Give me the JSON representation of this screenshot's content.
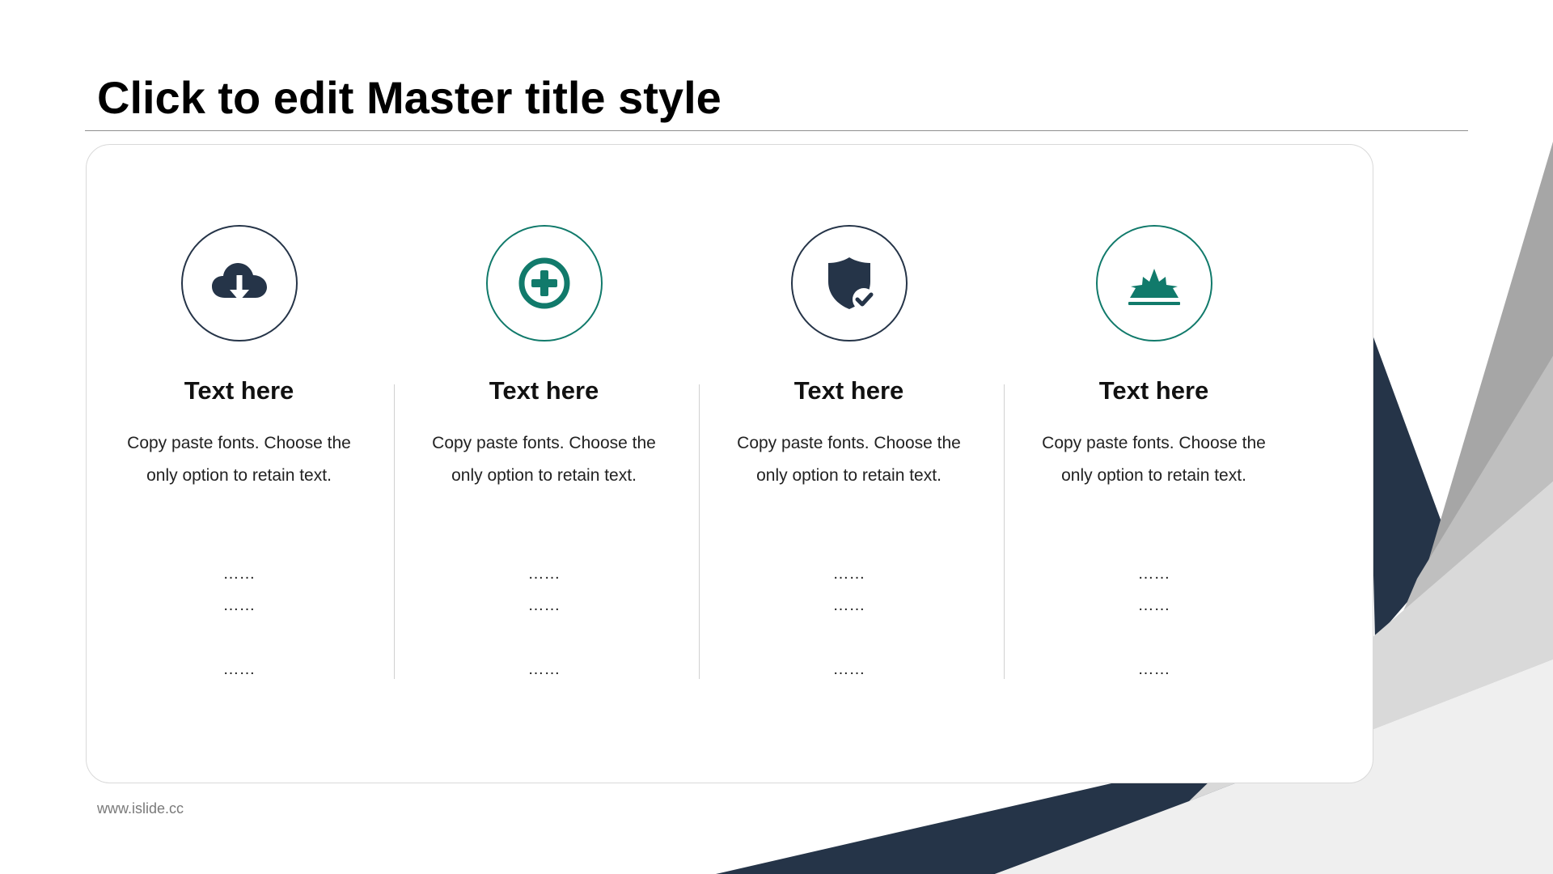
{
  "slide": {
    "title": "Click to edit Master title style",
    "footer": "www.islide.cc"
  },
  "colors": {
    "navy": "#253448",
    "teal": "#117a6b",
    "gray_dark": "#a6a6a6",
    "gray_mid": "#bfbfbf",
    "gray_light": "#d9d9d9",
    "gray_lightest": "#efefef"
  },
  "columns": [
    {
      "icon": "cloud-download-icon",
      "heading": "Text here",
      "body": "Copy paste fonts. Choose the only option to retain text.",
      "dots": [
        "……",
        "……",
        "……"
      ]
    },
    {
      "icon": "plus-circle-icon",
      "heading": "Text here",
      "body": "Copy paste fonts. Choose the only option to retain text.",
      "dots": [
        "……",
        "……",
        "……"
      ]
    },
    {
      "icon": "shield-check-icon",
      "heading": "Text here",
      "body": "Copy paste fonts. Choose the only option to retain text.",
      "dots": [
        "……",
        "……",
        "……"
      ]
    },
    {
      "icon": "sunrise-burst-icon",
      "heading": "Text here",
      "body": "Copy paste fonts. Choose the only option to retain text.",
      "dots": [
        "……",
        "……",
        "……"
      ]
    }
  ]
}
